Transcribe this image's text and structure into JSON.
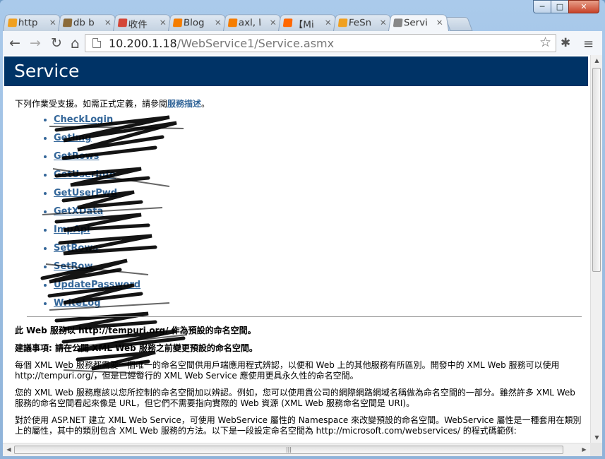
{
  "window": {
    "controls": {
      "minimize": "─",
      "maximize": "□",
      "close": "✕"
    }
  },
  "tabs": [
    {
      "title": "http",
      "icon": "loop-icon",
      "color": "#f0a020"
    },
    {
      "title": "db b",
      "icon": "image-icon",
      "color": "#8b6b3a"
    },
    {
      "title": "收件",
      "icon": "gmail-icon",
      "color": "#d44638"
    },
    {
      "title": "Blog",
      "icon": "blogger-icon",
      "color": "#f57d00"
    },
    {
      "title": "axl, l",
      "icon": "blogger-icon",
      "color": "#f57d00"
    },
    {
      "title": "【Mi",
      "icon": "mi-icon",
      "color": "#ff6700"
    },
    {
      "title": "FeSn",
      "icon": "loop-icon",
      "color": "#f0a020"
    },
    {
      "title": "Servi",
      "icon": "page-icon",
      "color": "#888888",
      "active": true
    }
  ],
  "toolbar": {
    "back": "←",
    "forward": "→",
    "reload": "↻",
    "home": "⌂",
    "url_host": "10.200.1.18",
    "url_path": "/WebService1/Service.asmx",
    "star": "☆",
    "ext": "✱",
    "menu": "≡"
  },
  "page": {
    "header": "Service",
    "intro_text": "下列作業受支援。如需正式定義，請參閱",
    "intro_link": "服務描述",
    "intro_end": "。",
    "operations": [
      "CheckLogin",
      "GetImg",
      "GetRows",
      "GetUserInfo",
      "GetUserPwd",
      "GetXData",
      "ImpApi",
      "SetRows",
      "SetRow",
      "UpdatePassword",
      "WriteLog"
    ],
    "p1": "此 Web 服務以 http://tempuri.org/ 作為預設的命名空間。",
    "p2": "建議事項: 請在公開 XML Web 服務之前變更預設的命名空間。",
    "p3": "每個 XML Web 服務都需要一個唯一的命名空間供用戶端應用程式辨認，以便和 Web 上的其他服務有所區別。開發中的 XML Web 服務可以使用 http://tempuri.org/，但是已經發行的 XML Web Service 應使用更具永久性的命名空間。",
    "p4": "您的 XML Web 服務應該以您所控制的命名空間加以辨認。例如，您可以使用貴公司的網際網路網域名稱做為命名空間的一部分。雖然許多 XML Web 服務的命名空間看起來像是 URL，但它們不需要指向實際的 Web 資源 (XML Web 服務命名空間是 URI)。",
    "p5": "對於使用 ASP.NET 建立 XML Web Service，可使用 WebService 屬性的 Namespace 來改變預設的命名空間。WebService 屬性是一種套用在類別上的屬性，其中的類別包含 XML Web 服務的方法。以下是一段設定命名空間為 http://microsoft.com/webservices/ 的程式碼範例:"
  },
  "colors": {
    "header_bg": "#003366",
    "link": "#336699"
  }
}
